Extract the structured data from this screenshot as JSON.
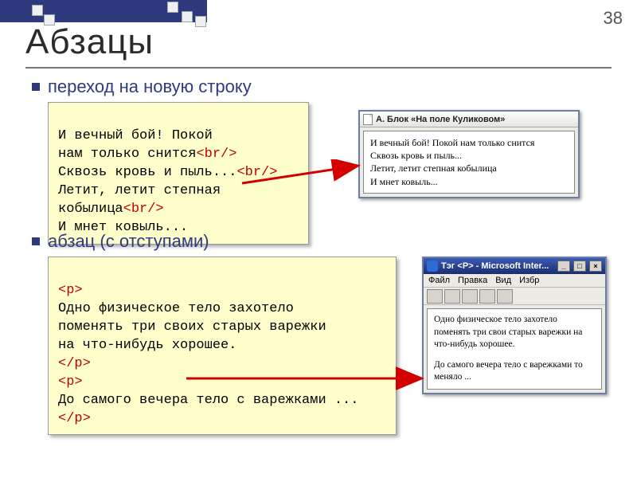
{
  "page_number": "38",
  "title": "Абзацы",
  "bullet1": "переход на новую строку",
  "bullet2": "абзац (с отступами)",
  "code1": {
    "l1": "И вечный бой! Покой",
    "l2a": "нам только снится",
    "l2tag": "<br/>",
    "l3a": "Сквозь кровь и пыль...",
    "l3tag": "<br/>",
    "l4": "Летит, летит степная",
    "l5a": "кобылица",
    "l5tag": "<br/>",
    "l6": "И мнет ковыль..."
  },
  "window1": {
    "title": "А. Блок «На поле Куликовом»",
    "line1": "И вечный бой! Покой нам только снится",
    "line2": "Сквозь кровь и пыль...",
    "line3": "Летит, летит степная кобылица",
    "line4": "И мнет ковыль..."
  },
  "code2": {
    "p_open": "<p>",
    "t1": "Одно физическое тело захотело",
    "t2": "поменять три своих старых варежки",
    "t3": "на что-нибудь хорошее.",
    "p_close": "</p>",
    "t4": "До самого вечера тело с варежками ..."
  },
  "window2": {
    "title": "Тэг <P> - Microsoft Inter...",
    "menu": {
      "file": "Файл",
      "edit": "Правка",
      "view": "Вид",
      "fav": "Избр"
    },
    "body1": "Одно физическое тело захотело поменять три свои старых варежки на что-нибудь хорошее.",
    "body2": "До самого вечера тело с варежками то меняло ..."
  },
  "win_buttons": {
    "min": "_",
    "max": "□",
    "close": "×"
  }
}
